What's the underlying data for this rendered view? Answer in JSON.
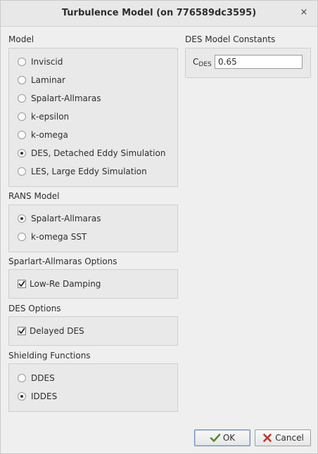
{
  "window": {
    "title": "Turbulence Model (on 776589dc3595)",
    "close_glyph": "×"
  },
  "model": {
    "label": "Model",
    "options": [
      {
        "label": "Inviscid",
        "checked": false
      },
      {
        "label": "Laminar",
        "checked": false
      },
      {
        "label": "Spalart-Allmaras",
        "checked": false
      },
      {
        "label": "k-epsilon",
        "checked": false
      },
      {
        "label": "k-omega",
        "checked": false
      },
      {
        "label": "DES, Detached Eddy Simulation",
        "checked": true
      },
      {
        "label": "LES, Large Eddy Simulation",
        "checked": false
      }
    ]
  },
  "rans": {
    "label": "RANS Model",
    "options": [
      {
        "label": "Spalart-Allmaras",
        "checked": true
      },
      {
        "label": "k-omega SST",
        "checked": false
      }
    ]
  },
  "sa_options": {
    "label": "Sparlart-Allmaras Options",
    "low_re": {
      "label": "Low-Re Damping",
      "checked": true
    }
  },
  "des_options": {
    "label": "DES Options",
    "delayed": {
      "label": "Delayed DES",
      "checked": true
    }
  },
  "shielding": {
    "label": "Shielding Functions",
    "options": [
      {
        "label": "DDES",
        "checked": false
      },
      {
        "label": "IDDES",
        "checked": true
      }
    ]
  },
  "constants": {
    "label": "DES Model Constants",
    "cdes_main": "C",
    "cdes_sub": "DES",
    "cdes_value": "0.65"
  },
  "buttons": {
    "ok": "OK",
    "cancel": "Cancel"
  },
  "colors": {
    "ok_icon": "#5a8a2c",
    "cancel_icon": "#c0392b"
  }
}
